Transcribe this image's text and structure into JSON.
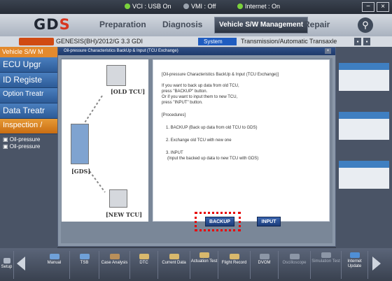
{
  "status": {
    "vci": "VCI : USB On",
    "vmi": "VMI : Off",
    "internet": "Internet : On"
  },
  "nav": {
    "logo_main": "GD",
    "logo_accent": "S",
    "tabs": [
      "Preparation",
      "Diagnosis",
      "Vehicle S/W Management",
      "Repair"
    ]
  },
  "vehicle": {
    "model": "GENESIS(BH)/2012/G 3.3 GDI",
    "system_label": "System",
    "system_value": "Transmission/Automatic Transaxle"
  },
  "sidebar": {
    "header": "Vehicle S/W M",
    "items": [
      "ECU Upgr",
      "ID Registe",
      "Option Treatr",
      "Data Treatr",
      "Inspection /"
    ],
    "subitems": [
      "Oil-pressure",
      "Oil-pressure"
    ]
  },
  "dialog": {
    "title": "Oil-pressure Characteristics BackUp & Input (TCU Exchange)",
    "lines": [
      "[Oil-pressure Characteristics BackUp & Input (TCU Exchange)]",
      "If you want to back up data from old TCU,",
      "press \"BACKUP\" button.",
      "Or if you want to input them to new TCU,",
      "press \"INPUT\" button.",
      "[Procedures]",
      "1. BACKUP (Back up data from old TCU to GDS)",
      "2. Exchange old TCU with new one",
      "3. INPUT",
      "(Input the backed up data to new TCU with GDS)"
    ],
    "labels": {
      "old": "[OLD TCU]",
      "gds": "[GDS]",
      "new": "[NEW TCU]"
    },
    "buttons": {
      "backup": "BACKUP",
      "input": "INPUT"
    }
  },
  "bottom": {
    "setup": "Setup",
    "buttons": [
      "Manual",
      "TSB",
      "Case Analysis",
      "DTC",
      "Current Data",
      "Actuation Test",
      "Flight Record",
      "DVOM",
      "Oscilloscope",
      "Simulation Test",
      "Internet Update"
    ]
  },
  "colors": {
    "accent_orange": "#e38a2e",
    "highlight_red": "#e60000",
    "button_blue": "#1b3c7a",
    "status_green": "#7bd23c"
  }
}
